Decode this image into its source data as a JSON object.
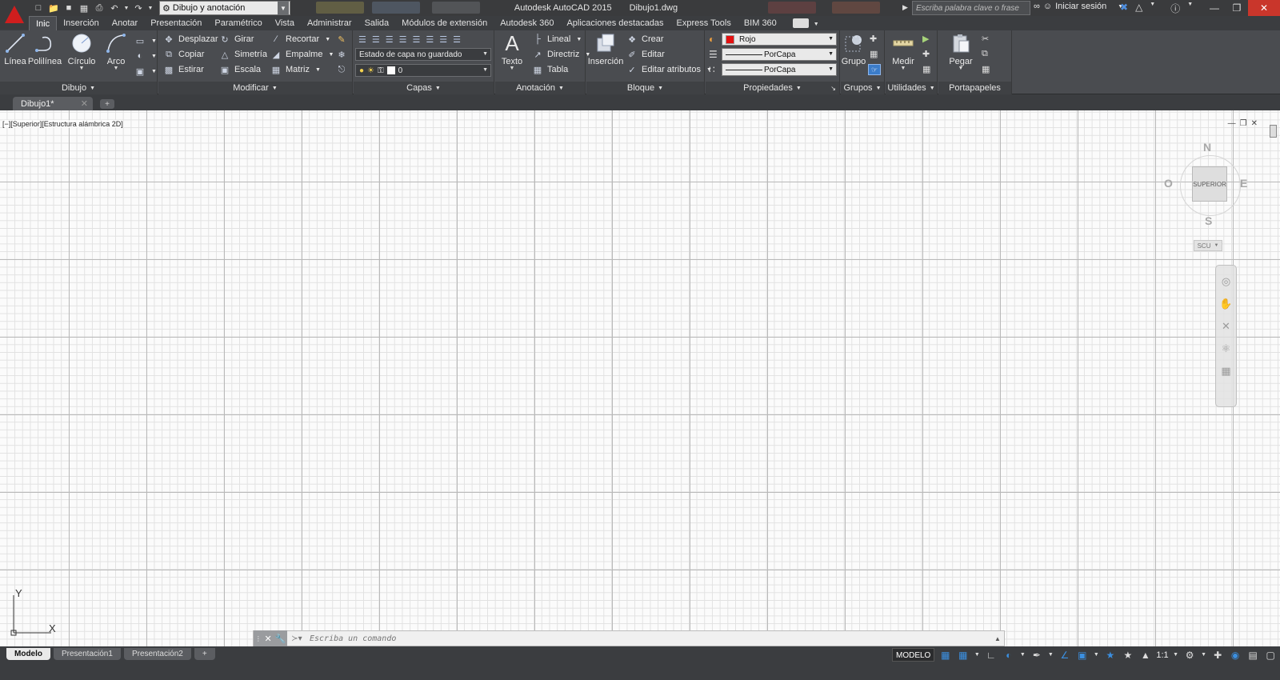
{
  "app": {
    "title": "Autodesk AutoCAD 2015",
    "document": "Dibujo1.dwg",
    "workspace": "Dibujo y anotación",
    "search_placeholder": "Escriba palabra clave o frase",
    "signin": "Iniciar sesión"
  },
  "colors": {
    "accent": "#d01e1e",
    "ribbon": "#4a4c50",
    "titlebar": "#3a3b3d",
    "grid_major": "#b9b9b9",
    "close": "#c9362b"
  },
  "ribbon_tabs": [
    "Inic",
    "Inserción",
    "Anotar",
    "Presentación",
    "Paramétrico",
    "Vista",
    "Administrar",
    "Salida",
    "Módulos de extensión",
    "Autodesk 360",
    "Aplicaciones destacadas",
    "Express Tools",
    "BIM 360"
  ],
  "panels": {
    "dibujo": {
      "title": "Dibujo",
      "linea": "Línea",
      "polilinea": "Polilínea",
      "circulo": "Círculo",
      "arco": "Arco"
    },
    "modificar": {
      "title": "Modificar",
      "desplazar": "Desplazar",
      "girar": "Girar",
      "recortar": "Recortar",
      "copiar": "Copiar",
      "simetria": "Simetría",
      "empalme": "Empalme",
      "estirar": "Estirar",
      "escala": "Escala",
      "matriz": "Matriz"
    },
    "capas": {
      "title": "Capas",
      "layer_state": "Estado de capa no guardado",
      "layer": "0"
    },
    "anotacion": {
      "title": "Anotación",
      "texto": "Texto",
      "lineal": "Lineal",
      "directriz": "Directriz",
      "tabla": "Tabla"
    },
    "bloque": {
      "title": "Bloque",
      "insercion": "Inserción",
      "crear": "Crear",
      "editar": "Editar",
      "editar_atributos": "Editar atributos"
    },
    "propiedades": {
      "title": "Propiedades",
      "color": "Rojo",
      "lineweight": "PorCapa",
      "linetype": "PorCapa"
    },
    "grupos": {
      "title": "Grupos",
      "grupo": "Grupo"
    },
    "utilidades": {
      "title": "Utilidades",
      "medir": "Medir"
    },
    "portapapeles": {
      "title": "Portapapeles",
      "pegar": "Pegar"
    }
  },
  "file_tab": {
    "label": "Dibujo1*"
  },
  "viewport": {
    "label": "[−][Superior][Estructura alámbrica 2D]",
    "viewcube": {
      "north": "N",
      "south": "S",
      "east": "E",
      "west": "O",
      "face": "SUPERIOR",
      "wcs": "SCU"
    }
  },
  "ucs": {
    "x": "X",
    "y": "Y"
  },
  "command": {
    "placeholder": "Escriba un comando"
  },
  "layouts": [
    "Modelo",
    "Presentación1",
    "Presentación2"
  ],
  "status": {
    "mode": "MODELO",
    "scale": "1:1"
  }
}
